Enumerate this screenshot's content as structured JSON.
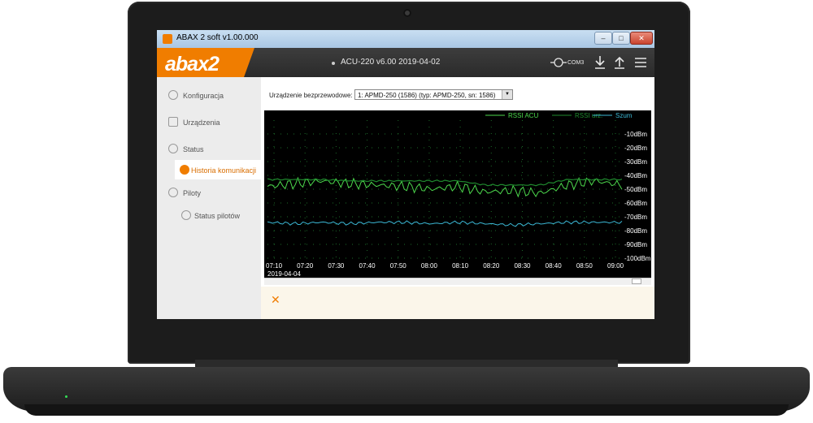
{
  "window": {
    "title": "ABAX 2 soft v1.00.000",
    "buttons": {
      "min": "–",
      "max": "□",
      "close": "✕"
    }
  },
  "header": {
    "logo": "abax2",
    "device_info": "ACU-220 v6.00 2019-04-02",
    "com_label": "COM3",
    "icons": [
      "connection-icon",
      "download-icon",
      "upload-icon",
      "menu-icon"
    ]
  },
  "sidebar": {
    "items": [
      {
        "label": "Konfiguracja",
        "icon": "gear-icon"
      },
      {
        "label": "Urządzenia",
        "icon": "device-icon"
      },
      {
        "label": "Status",
        "icon": "status-icon"
      },
      {
        "label": "Historia komunikacji",
        "icon": "history-icon",
        "active": true
      },
      {
        "label": "Piloty",
        "icon": "remote-icon"
      },
      {
        "label": "Status pilotów",
        "icon": "remote-status-icon"
      }
    ]
  },
  "main": {
    "device_label": "Urządzenie bezprzewodowe:",
    "device_select": "1: APMD-250 (1586)  (typ: APMD-250, sn: 1586)"
  },
  "colors": {
    "accent": "#f07d00",
    "rssi_acu": "#4cd84c",
    "rssi_urz": "#1f8a2e",
    "szum": "#3bb7d4"
  },
  "chart_data": {
    "type": "line",
    "x_ticks": [
      "07:10",
      "07:20",
      "07:30",
      "07:40",
      "07:50",
      "08:00",
      "08:10",
      "08:20",
      "08:30",
      "08:40",
      "08:50",
      "09:00"
    ],
    "date_label": "2019-04-04",
    "y_ticks": [
      "-10dBm",
      "-20dBm",
      "-30dBm",
      "-40dBm",
      "-50dBm",
      "-60dBm",
      "-70dBm",
      "-80dBm",
      "-90dBm",
      "-100dBm"
    ],
    "ylim": [
      -100,
      0
    ],
    "legend_position": "top-right",
    "series": [
      {
        "name": "RSSI ACU",
        "color": "#4cd84c",
        "x": [
          0,
          1,
          2,
          3,
          4,
          5,
          6,
          7,
          8,
          9,
          10,
          11,
          12,
          13
        ],
        "values": [
          -48,
          -46,
          -44,
          -46,
          -47,
          -48,
          -50,
          -48,
          -52,
          -51,
          -53,
          -47,
          -44,
          -47
        ]
      },
      {
        "name": "RSSI urz.",
        "color": "#1f8a2e",
        "x": [
          0,
          1,
          2,
          3,
          4,
          5,
          6,
          7,
          8,
          9,
          10,
          11,
          12,
          13
        ],
        "values": [
          -43,
          -43,
          -43,
          -44,
          -44,
          -44,
          -44,
          -44,
          -47,
          -47,
          -47,
          -43,
          -43,
          -43
        ]
      },
      {
        "name": "Szum",
        "color": "#3bb7d4",
        "x": [
          0,
          1,
          2,
          3,
          4,
          5,
          6,
          7,
          8,
          9,
          10,
          11,
          12,
          13
        ],
        "values": [
          -74,
          -75,
          -74,
          -75,
          -74,
          -74,
          -75,
          -74,
          -75,
          -76,
          -75,
          -74,
          -74,
          -74
        ]
      }
    ]
  }
}
